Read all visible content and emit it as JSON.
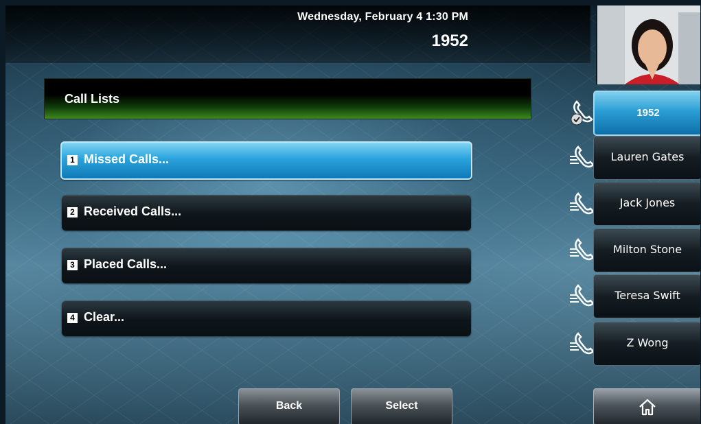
{
  "status": {
    "datetime": "Wednesday, February 4  1:30 PM",
    "extension": "1952"
  },
  "screen_title": "Call Lists",
  "menu": [
    {
      "num": "1",
      "label": "Missed Calls...",
      "selected": true
    },
    {
      "num": "2",
      "label": "Received Calls...",
      "selected": false
    },
    {
      "num": "3",
      "label": "Placed Calls...",
      "selected": false
    },
    {
      "num": "4",
      "label": "Clear...",
      "selected": false
    }
  ],
  "lines": [
    {
      "label": "1952",
      "icon": "phone-registered-icon",
      "active": true
    },
    {
      "label": "Lauren Gates",
      "icon": "phone-icon",
      "active": false
    },
    {
      "label": "Jack Jones",
      "icon": "phone-icon",
      "active": false
    },
    {
      "label": "Milton Stone",
      "icon": "phone-icon",
      "active": false
    },
    {
      "label": "Teresa Swift",
      "icon": "phone-icon",
      "active": false
    },
    {
      "label": "Z Wong",
      "icon": "phone-icon",
      "active": false
    }
  ],
  "softkeys": {
    "back": "Back",
    "select": "Select",
    "home_icon": "home-icon"
  },
  "colors": {
    "selected_blue": "#2aa3dc",
    "title_green": "#3c8a1c"
  }
}
